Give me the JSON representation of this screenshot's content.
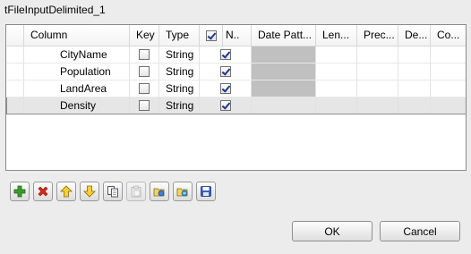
{
  "dialog": {
    "title": "tFileInputDelimited_1"
  },
  "table": {
    "columns": [
      "Column",
      "Key",
      "Type",
      "N..",
      "Date Patt...",
      "Len...",
      "Prec...",
      "De...",
      "Co..."
    ],
    "header_checkbox_checked": true,
    "rows": [
      {
        "column": "CityName",
        "key": false,
        "type": "String",
        "nullable": true
      },
      {
        "column": "Population",
        "key": false,
        "type": "String",
        "nullable": true
      },
      {
        "column": "LandArea",
        "key": false,
        "type": "String",
        "nullable": true
      },
      {
        "column": "Density",
        "key": false,
        "type": "String",
        "nullable": true
      }
    ]
  },
  "toolbar": {
    "icons": [
      "add-icon",
      "remove-icon",
      "move-up-icon",
      "move-down-icon",
      "copy-icon",
      "paste-icon",
      "import-icon",
      "export-icon",
      "save-icon"
    ]
  },
  "buttons": {
    "ok": "OK",
    "cancel": "Cancel"
  }
}
